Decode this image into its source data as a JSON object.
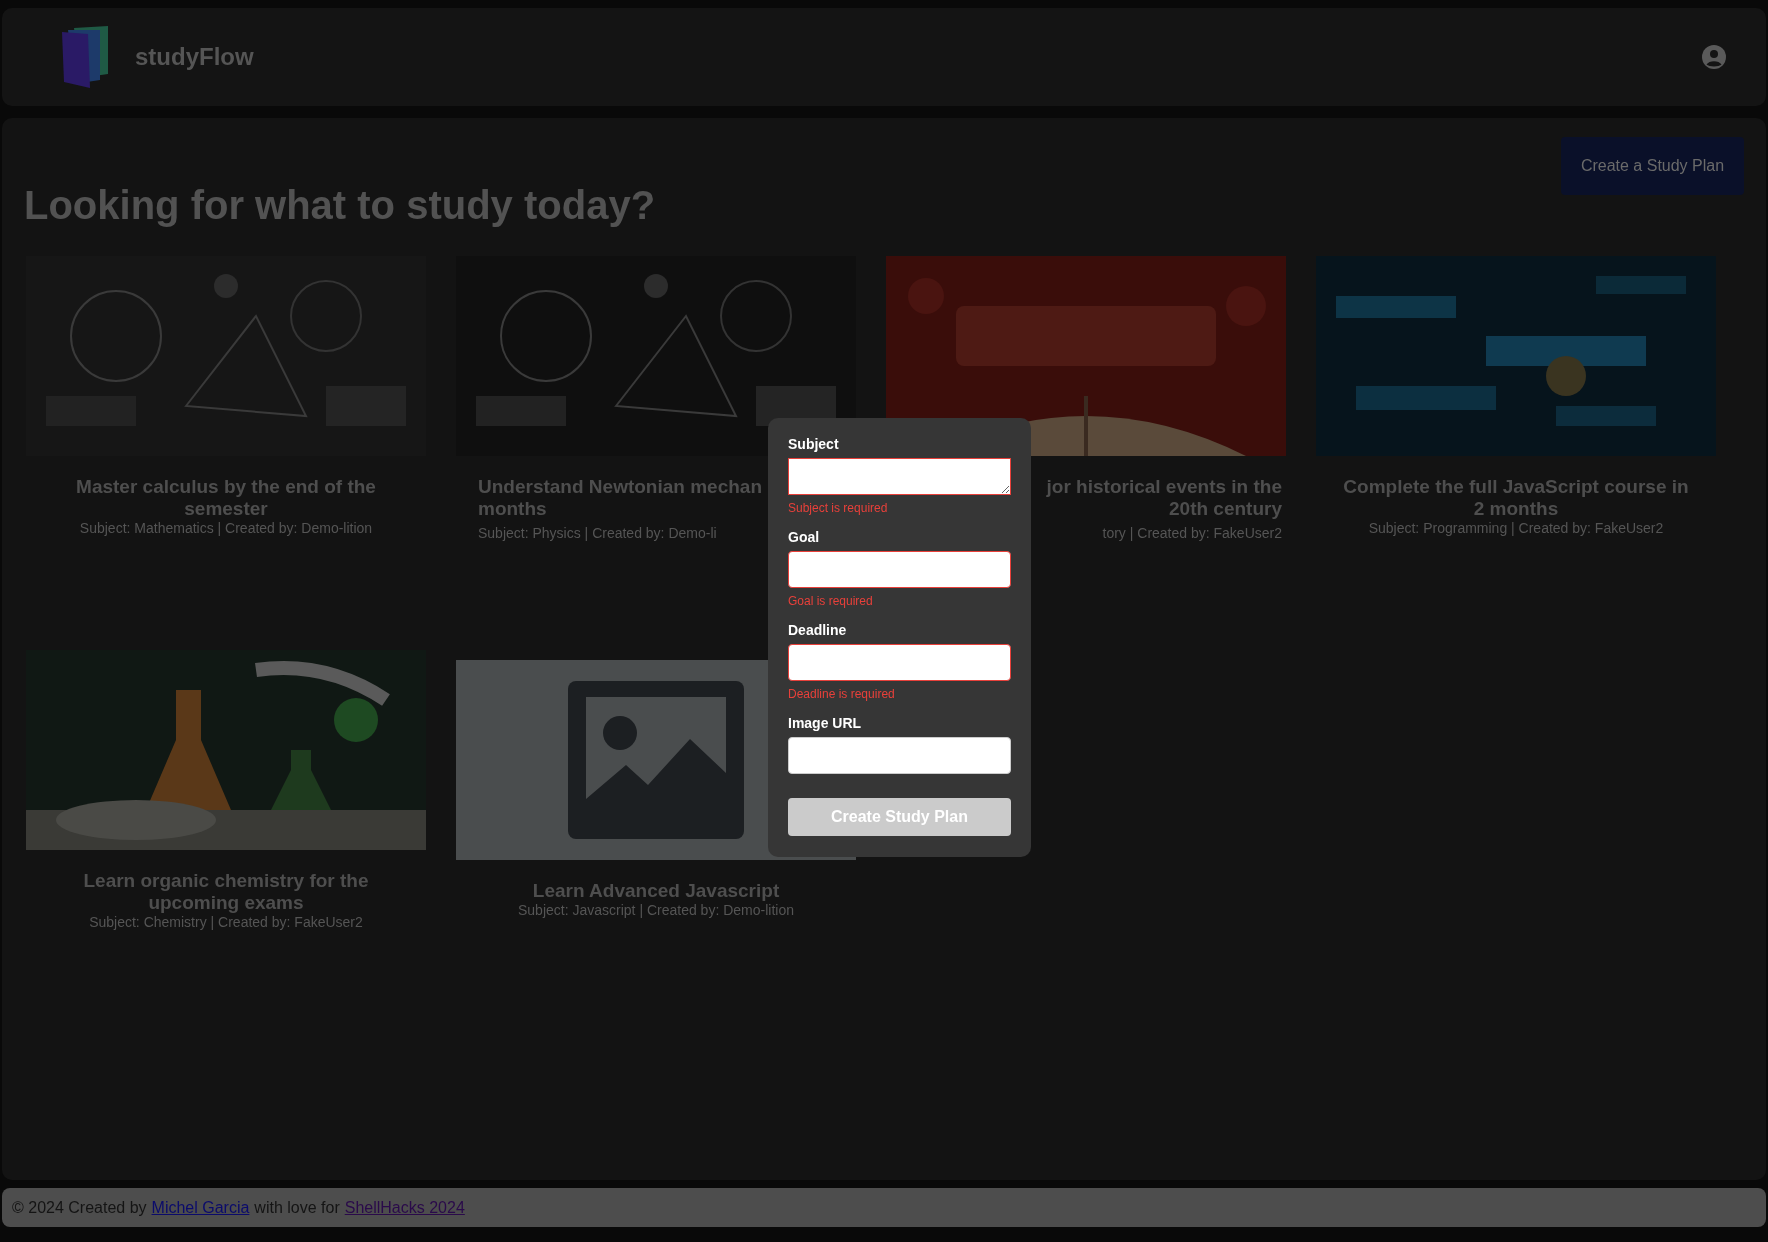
{
  "header": {
    "brand": "studyFlow"
  },
  "page": {
    "heading": "Looking for what to study today?",
    "create_button": "Create a Study Plan"
  },
  "cards": [
    {
      "title_lines": [
        "Master calculus by the end of the",
        "semester"
      ],
      "meta": "Subject: Mathematics | Created by: Demo-lition"
    },
    {
      "title_lines": [
        "Understand Newtonian mechan",
        "months"
      ],
      "meta": "Subject: Physics | Created by: Demo-li"
    },
    {
      "title_lines": [
        "jor historical events in the",
        "20th century"
      ],
      "meta": "tory | Created by: FakeUser2"
    },
    {
      "title_lines": [
        "Complete the full JavaScript course in",
        "2 months"
      ],
      "meta": "Subject: Programming | Created by: FakeUser2"
    },
    {
      "title_lines": [
        "Learn organic chemistry for the",
        "upcoming exams"
      ],
      "meta": "Subject: Chemistry | Created by: FakeUser2"
    },
    {
      "image": {
        "kind": "placeholder"
      },
      "title_lines": [
        "Learn Advanced Javascript"
      ],
      "meta": "Subject: Javascript | Created by: Demo-lition"
    }
  ],
  "modal": {
    "fields": [
      {
        "label": "Subject",
        "kind": "textarea",
        "error": "Subject is required"
      },
      {
        "label": "Goal",
        "kind": "input",
        "error": "Goal is required"
      },
      {
        "label": "Deadline",
        "kind": "input",
        "error": "Deadline is required"
      },
      {
        "label": "Image URL",
        "kind": "input"
      }
    ],
    "submit": {
      "label": "Create Study Plan",
      "disabled": true
    }
  },
  "footer": {
    "prefix": "© 2024 Created by",
    "author_link": "Michel Garcia",
    "middle": "with love for",
    "event_link": "ShellHacks 2024"
  }
}
